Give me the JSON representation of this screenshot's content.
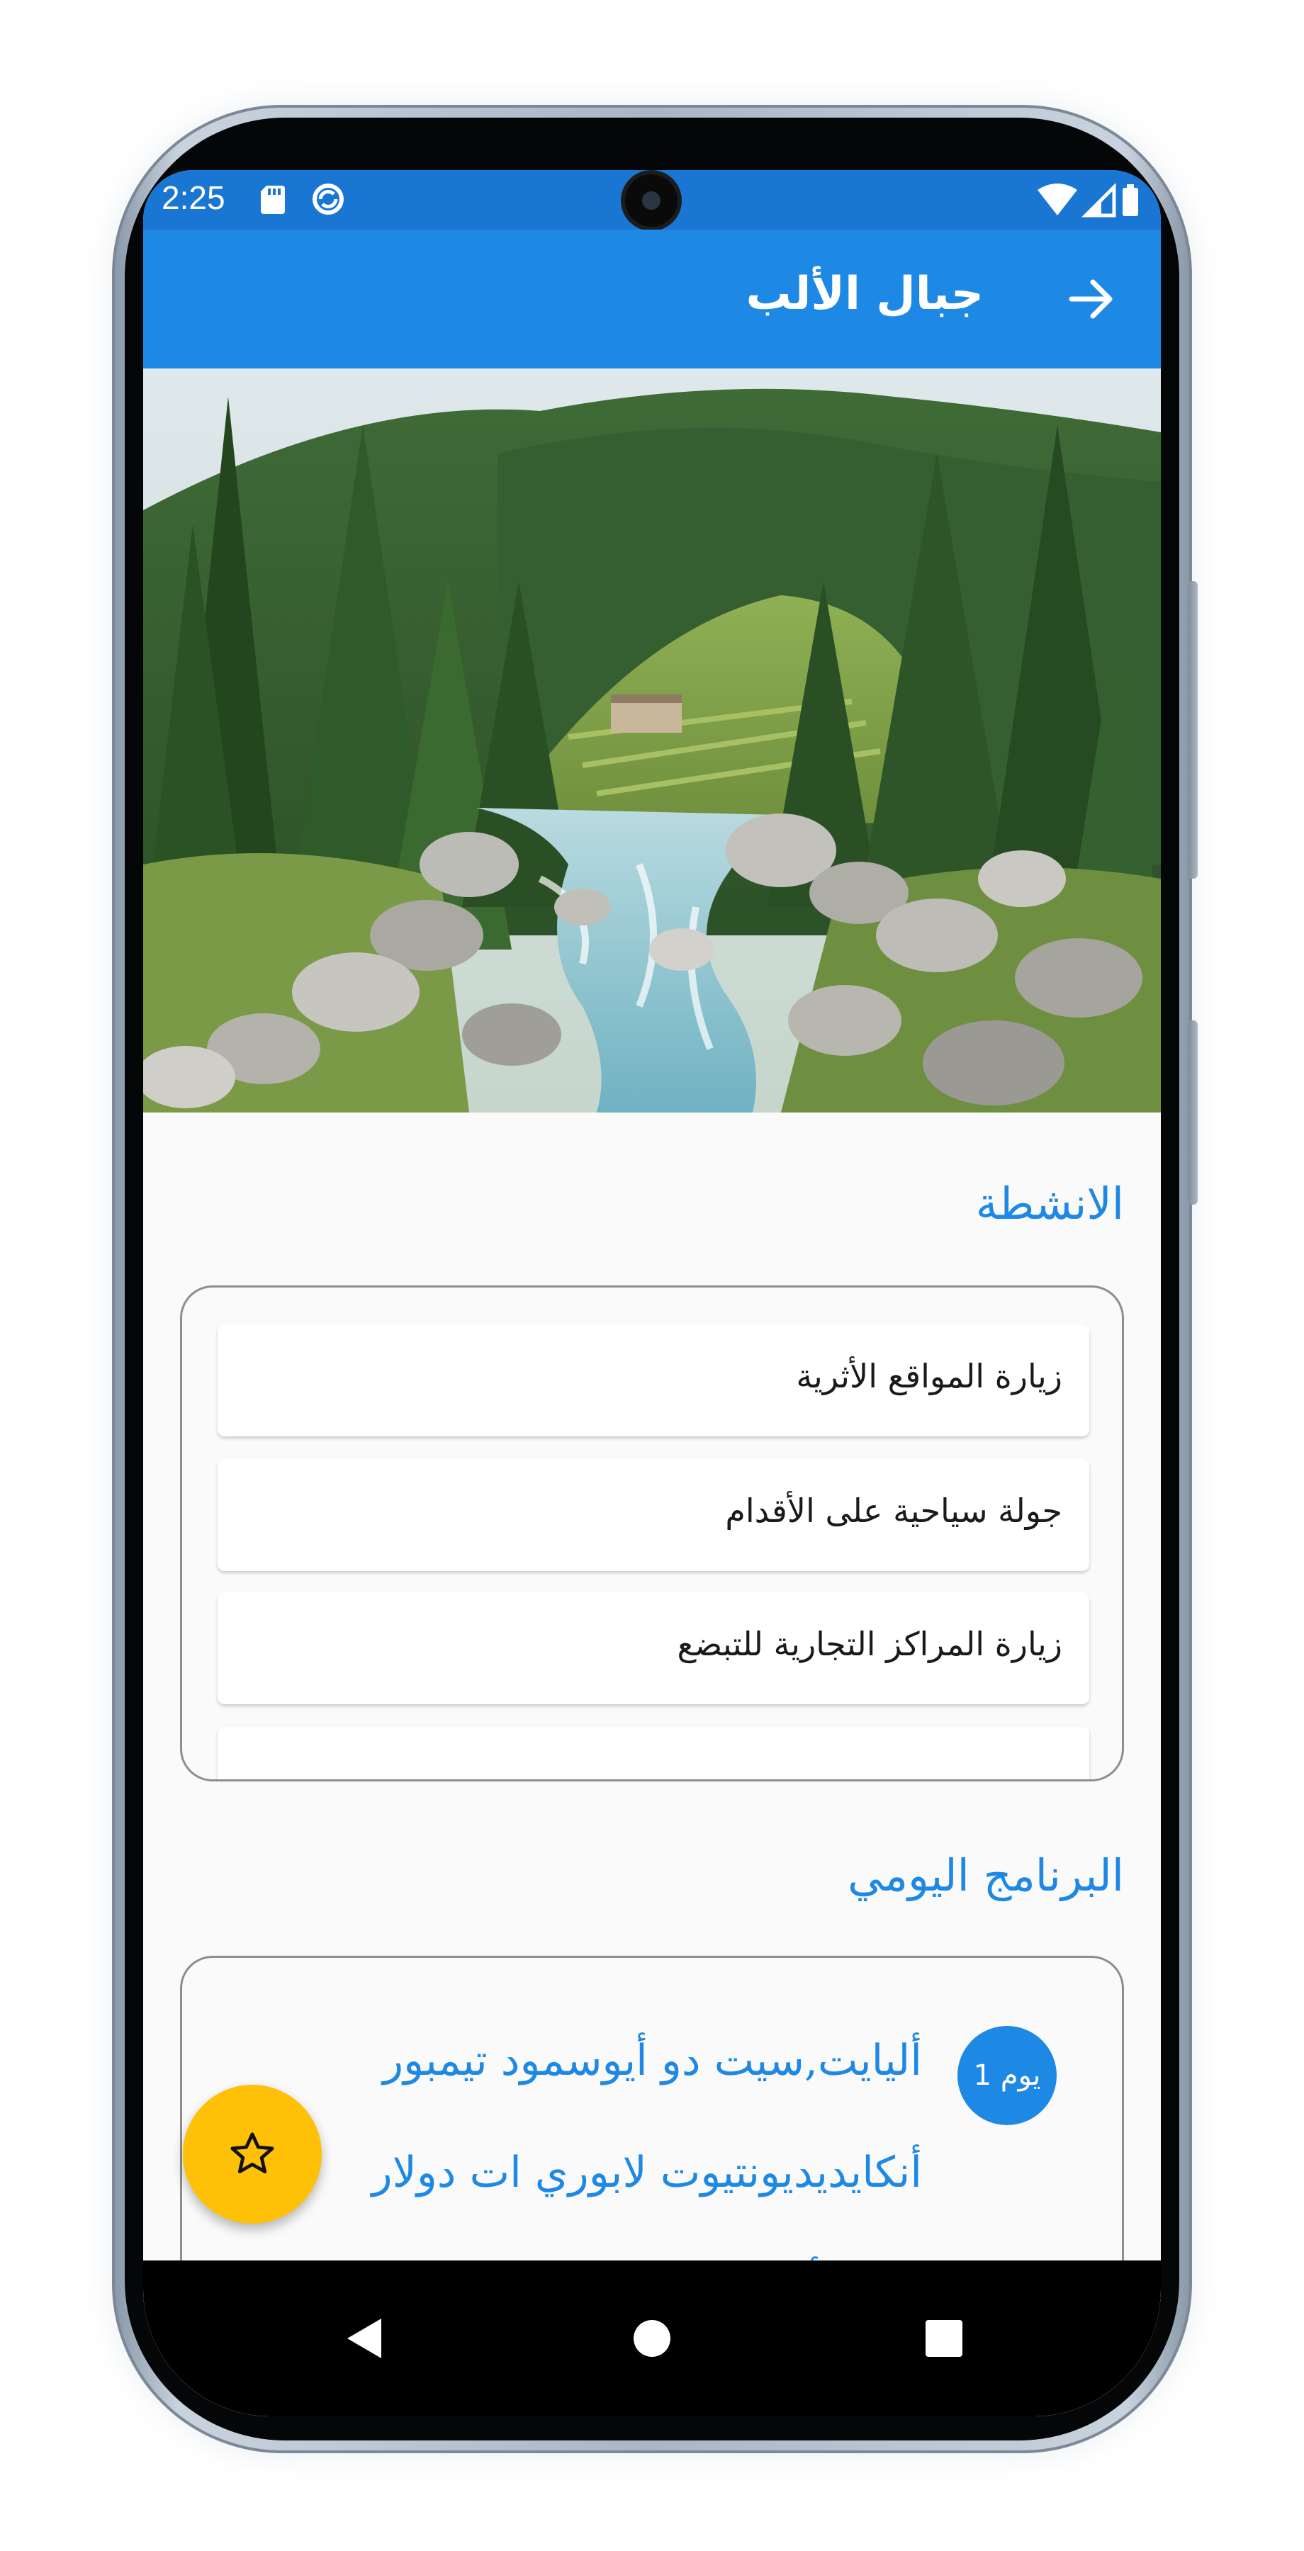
{
  "status_bar": {
    "time": "2:25",
    "icons": [
      "sd-card-icon",
      "sync-icon",
      "wifi-icon",
      "cell-signal-icon",
      "battery-icon"
    ]
  },
  "app_bar": {
    "title": "جبال الألب",
    "back_icon": "arrow-right-icon"
  },
  "hero": {
    "description": "mountain-river-forest-photo"
  },
  "activities": {
    "title": "الانشطة",
    "items": [
      {
        "label": "زيارة المواقع الأثرية"
      },
      {
        "label": "جولة سياحية على الأقدام"
      },
      {
        "label": "زيارة المراكز التجارية للتبضع"
      }
    ]
  },
  "program": {
    "title": "البرنامج اليومي",
    "day_badge": "يوم 1",
    "day_text_lines": [
      "أليايت,سيت دو أيوسمود تيمبور",
      "أنكايديديونتيوت لابوري ات دولار",
      "ماجنا أليكيوا."
    ]
  },
  "fab": {
    "icon": "star-outline-icon"
  },
  "nav_bar": {
    "icons": [
      "back-triangle-icon",
      "home-circle-icon",
      "recents-square-icon"
    ]
  },
  "colors": {
    "primary": "#1e88e5",
    "status_bar": "#1976d2",
    "accent": "#ffc107",
    "background": "#fafafa"
  }
}
